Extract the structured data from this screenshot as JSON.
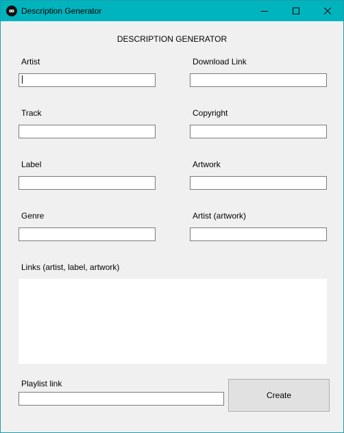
{
  "window": {
    "title": "Description Generator",
    "icon": "infinity-logo-icon"
  },
  "form": {
    "heading": "DESCRIPTION GENERATOR",
    "fields": {
      "artist": {
        "label": "Artist",
        "value": ""
      },
      "download_link": {
        "label": "Download Link",
        "value": ""
      },
      "track": {
        "label": "Track",
        "value": ""
      },
      "copyright": {
        "label": "Copyright",
        "value": ""
      },
      "label": {
        "label": "Label",
        "value": ""
      },
      "artwork": {
        "label": "Artwork",
        "value": ""
      },
      "genre": {
        "label": "Genre",
        "value": ""
      },
      "artist_artwork": {
        "label": "Artist (artwork)",
        "value": ""
      },
      "links": {
        "label": "Links (artist, label, artwork)",
        "value": ""
      },
      "playlist_link": {
        "label": "Playlist link",
        "value": ""
      }
    },
    "create_label": "Create"
  },
  "colors": {
    "titlebar": "#00b4be",
    "background": "#f0f0f0",
    "button": "#e1e1e1"
  }
}
